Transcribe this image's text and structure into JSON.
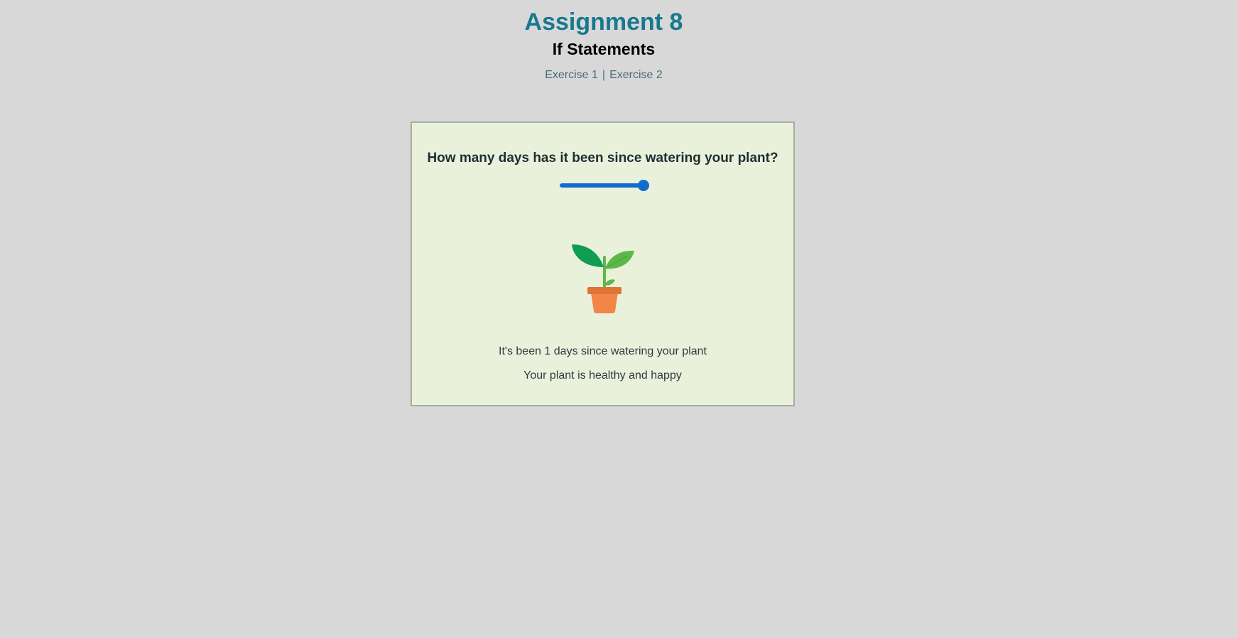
{
  "header": {
    "title": "Assignment 8",
    "subtitle": "If Statements",
    "nav": {
      "links": [
        "Exercise 1",
        "Exercise 2"
      ],
      "separator": "|"
    }
  },
  "card": {
    "question": "How many days has it been since watering your plant?",
    "slider": {
      "value_fraction": 1.0
    },
    "plant_icon": "potted-sprout-icon",
    "status_line": "It's been 1 days since watering your plant",
    "health_message": "Your plant is healthy and happy"
  },
  "colors": {
    "background": "#d8d8d8",
    "title": "#18798e",
    "card_background": "#eaf1db",
    "card_border": "#a5ada0",
    "slider_accent": "#0f6ecd",
    "leaf_dark": "#119c54",
    "leaf_light": "#5db84a",
    "pot": "#f28648",
    "pot_rim": "#df7436"
  }
}
